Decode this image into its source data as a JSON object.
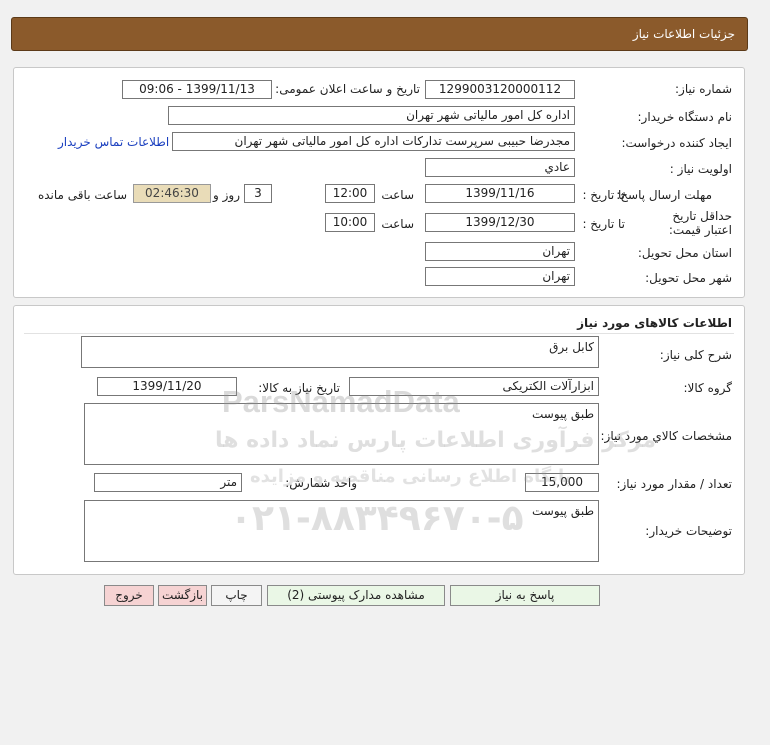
{
  "header": {
    "title": "جزئیات اطلاعات نیاز"
  },
  "info": {
    "need_number_label": "شماره نیاز:",
    "need_number": "1299003120000112",
    "announce_label": "تاریخ و ساعت اعلان عمومی:",
    "announce_value": "1399/11/13 - 09:06",
    "buyer_org_label": "نام دستگاه خریدار:",
    "buyer_org": "اداره کل امور مالیاتی شهر تهران",
    "creator_label": "ایجاد کننده درخواست:",
    "creator": "مجدرضا حبیبی سرپرست تدارکات اداره کل امور مالیاتی شهر تهران",
    "contact_link": "اطلاعات تماس خریدار",
    "priority_label": "اولویت نیاز :",
    "priority": "عادي",
    "deadline_label": "مهلت ارسال پاسخ:",
    "to_date_label": "تا تاریخ :",
    "deadline_date": "1399/11/16",
    "time_label": "ساعت",
    "deadline_time": "12:00",
    "days_value": "3",
    "days_label": "روز و",
    "remaining_time": "02:46:30",
    "remaining_label": "ساعت باقی مانده",
    "validity_label": "حداقل تاریخ اعتبار قیمت:",
    "validity_to_label": "تا تاریخ :",
    "validity_date": "1399/12/30",
    "validity_time_label": "ساعت",
    "validity_time": "10:00",
    "province_label": "استان محل تحویل:",
    "province": "تهران",
    "city_label": "شهر محل تحویل:",
    "city": "تهران"
  },
  "goods": {
    "section_title": "اطلاعات کالاهای مورد نیاز",
    "desc_label": "شرح کلی نیاز:",
    "desc": "کابل برق",
    "group_label": "گروه کالا:",
    "group": "ابزارآلات الکتریکی",
    "need_date_label": "تاریخ نیاز به کالا:",
    "need_date": "1399/11/20",
    "specs_label": "مشخصات کالاي مورد نياز:",
    "specs": "طبق پیوست",
    "qty_label": "تعداد / مقدار مورد نیاز:",
    "qty": "15,000",
    "unit_label": "واحد شمارش:",
    "unit": "متر",
    "buyer_notes_label": "توضیحات خریدار:",
    "buyer_notes": "طبق پیوست"
  },
  "buttons": {
    "reply": "پاسخ به نیاز",
    "view_docs": "مشاهده مدارک پیوستی (2)",
    "print": "چاپ",
    "back": "بازگشت",
    "exit": "خروج"
  },
  "watermark": {
    "brand": "ParsNamadData",
    "line1": "مرکز فرآوری اطلاعات پارس نماد داده ها",
    "line2": "پایگاه اطلاع رسانی مناقصه و مزایده",
    "phone": "۰۲۱-۸۸۳۴۹۶۷۰-۵"
  }
}
